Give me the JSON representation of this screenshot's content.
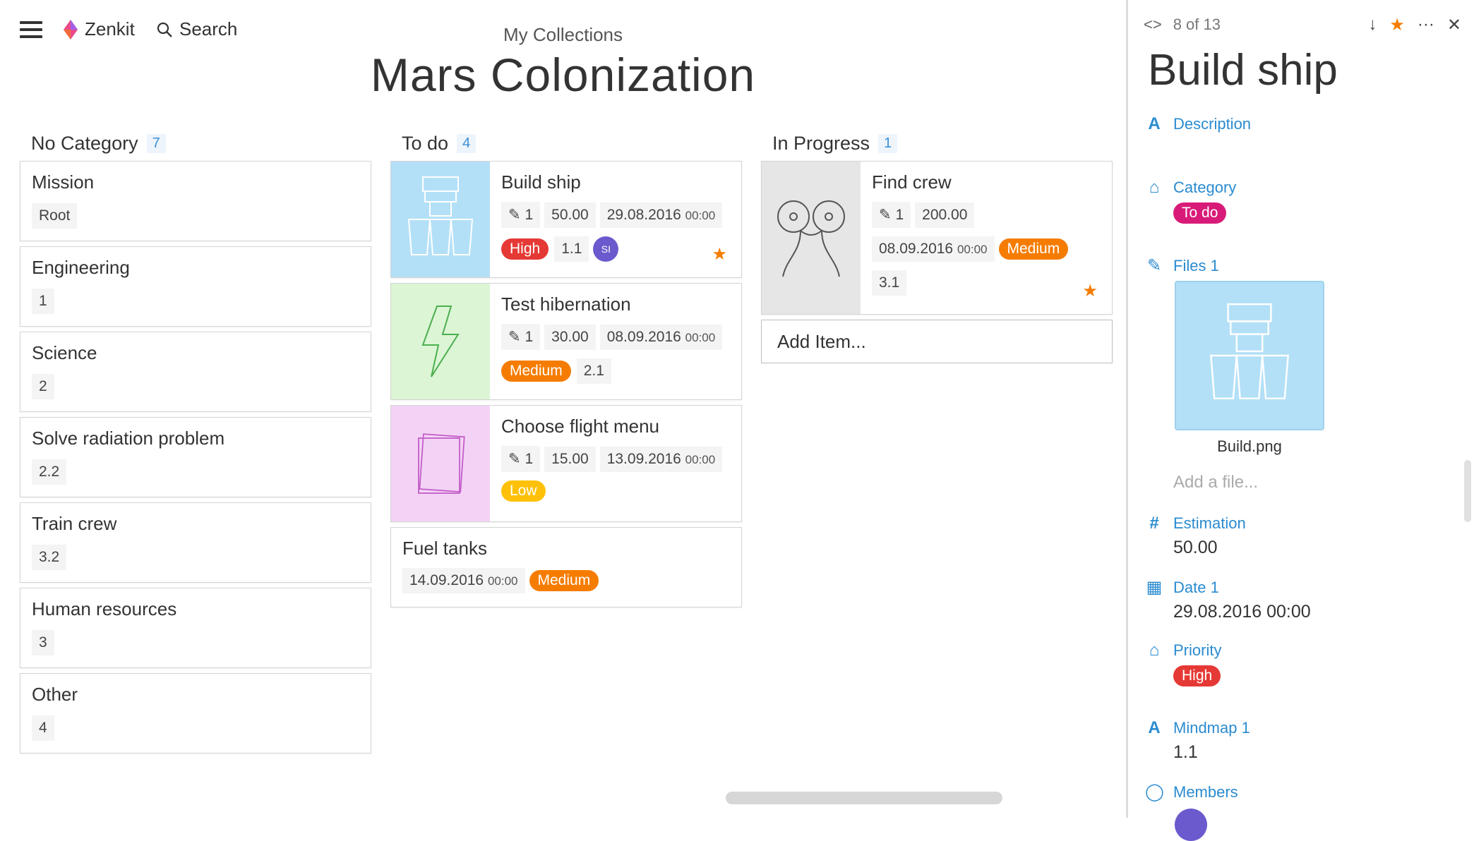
{
  "topbar": {
    "brand": "Zenkit",
    "search_label": "Search",
    "breadcrumb": "My Collections",
    "title": "Mars Colonization"
  },
  "columns": {
    "no_category": {
      "title": "No Category",
      "count": "7",
      "cards": [
        {
          "title": "Mission",
          "chip": "Root"
        },
        {
          "title": "Engineering",
          "chip": "1"
        },
        {
          "title": "Science",
          "chip": "2"
        },
        {
          "title": "Solve radiation problem",
          "chip": "2.2"
        },
        {
          "title": "Train crew",
          "chip": "3.2"
        },
        {
          "title": "Human resources",
          "chip": "3"
        },
        {
          "title": "Other",
          "chip": "4"
        }
      ]
    },
    "todo": {
      "title": "To do",
      "count": "4",
      "cards": [
        {
          "title": "Build ship",
          "files": "1",
          "estimation": "50.00",
          "date": "29.08.2016",
          "time": "00:00",
          "priority": "High",
          "mindmap": "1.1",
          "member": "SI",
          "image_color": "#b3e0f7"
        },
        {
          "title": "Test hibernation",
          "files": "1",
          "estimation": "30.00",
          "date": "08.09.2016",
          "time": "00:00",
          "priority": "Medium",
          "mindmap": "2.1",
          "image_color": "#dcf5d5"
        },
        {
          "title": "Choose flight menu",
          "files": "1",
          "estimation": "15.00",
          "date": "13.09.2016",
          "time": "00:00",
          "priority": "Low",
          "image_color": "#f3d3f5"
        },
        {
          "title": "Fuel tanks",
          "date": "14.09.2016",
          "time": "00:00",
          "priority": "Medium"
        }
      ]
    },
    "in_progress": {
      "title": "In Progress",
      "count": "1",
      "cards": [
        {
          "title": "Find crew",
          "files": "1",
          "estimation": "200.00",
          "date": "08.09.2016",
          "time": "00:00",
          "priority": "Medium",
          "mindmap": "3.1",
          "image_color": "#e6e6e6"
        }
      ],
      "add_item": "Add Item..."
    }
  },
  "panel": {
    "position": "8 of 13",
    "title": "Build ship",
    "description_label": "Description",
    "category_label": "Category",
    "category_value": "To do",
    "files_label": "Files 1",
    "file_name": "Build.png",
    "add_file": "Add a file...",
    "estimation_label": "Estimation",
    "estimation_value": "50.00",
    "date_label": "Date 1",
    "date_value": "29.08.2016 00:00",
    "priority_label": "Priority",
    "priority_value": "High",
    "mindmap_label": "Mindmap 1",
    "mindmap_value": "1.1",
    "members_label": "Members"
  },
  "colors": {
    "accent": "#2a8bd0",
    "high": "#e53935",
    "medium": "#f57c00",
    "low": "#ffc107",
    "category": "#d81b78",
    "star": "#f57c00"
  }
}
